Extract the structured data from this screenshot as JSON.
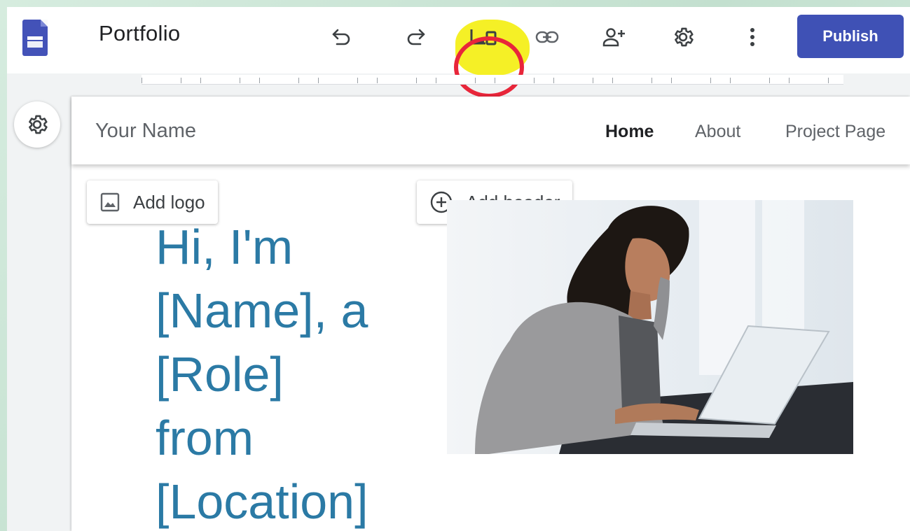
{
  "toolbar": {
    "title": "Portfolio",
    "publish_label": "Publish",
    "icons": [
      "undo-icon",
      "redo-icon",
      "preview-devices-icon",
      "insert-link-icon",
      "share-with-others-icon",
      "settings-icon",
      "more-options-icon"
    ]
  },
  "nav": {
    "site_name": "Your Name",
    "links": [
      "Home",
      "About",
      "Project Page"
    ],
    "active": "Home"
  },
  "chips": {
    "add_logo": "Add logo",
    "add_header": "Add header"
  },
  "hero": {
    "lines": [
      "Hi, I'm",
      "[Name], a",
      "[Role]",
      "from",
      "[Location]"
    ]
  },
  "colors": {
    "accent": "#3f51b5",
    "hero_text": "#2b7aa5",
    "highlight_yellow": "#f4ef1a",
    "highlight_red": "#e8263a",
    "frame_green": "#cfe6d8"
  }
}
